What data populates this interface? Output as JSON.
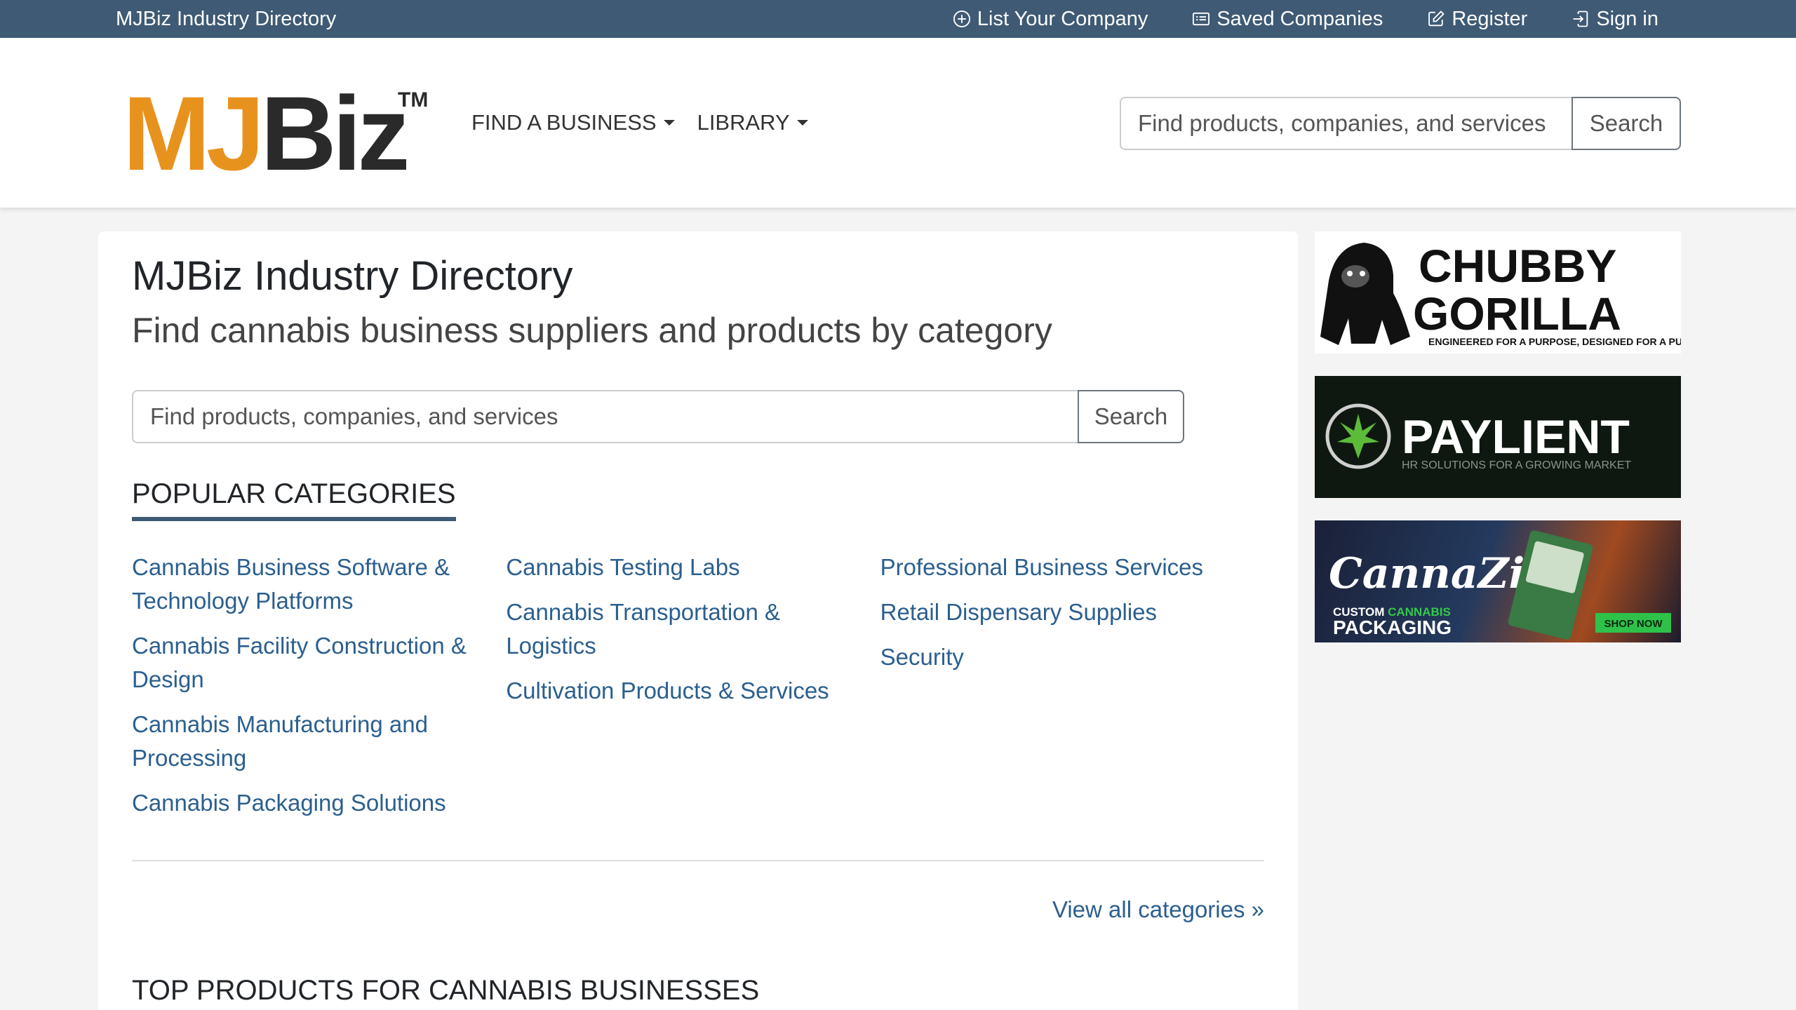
{
  "topbar": {
    "brand": "MJBiz Industry Directory",
    "links": {
      "list_company": "List Your Company",
      "saved_companies": "Saved Companies",
      "register": "Register",
      "sign_in": "Sign in"
    }
  },
  "header": {
    "logo_text": "MJBiz",
    "logo_tm": "TM",
    "nav": {
      "find_business": "FIND A BUSINESS",
      "library": "LIBRARY"
    },
    "search": {
      "placeholder": "Find products, companies, and services",
      "button": "Search"
    }
  },
  "main": {
    "title": "MJBiz Industry Directory",
    "subtitle": "Find cannabis business suppliers and products by category",
    "search": {
      "placeholder": "Find products, companies, and services",
      "button": "Search"
    },
    "popular_heading": "POPULAR CATEGORIES",
    "categories": {
      "col1": [
        "Cannabis Business Software & Technology Platforms",
        "Cannabis Facility Construction & Design",
        "Cannabis Manufacturing and Processing",
        "Cannabis Packaging Solutions"
      ],
      "col2": [
        "Cannabis Testing Labs",
        "Cannabis Transportation & Logistics",
        "Cultivation Products & Services"
      ],
      "col3": [
        "Professional Business Services",
        "Retail Dispensary Supplies",
        "Security"
      ]
    },
    "view_all": "View all categories »",
    "top_products_heading": "TOP PRODUCTS FOR CANNABIS BUSINESSES"
  },
  "ads": {
    "chubby": {
      "line1": "CHUBBY",
      "line2": "GORILLA",
      "tagline": "ENGINEERED FOR A PURPOSE, DESIGNED FOR A PURPOSE"
    },
    "paylient": {
      "name": "PAYLIENT",
      "tagline": "HR SOLUTIONS FOR A GROWING MARKET"
    },
    "cannazip": {
      "brand": "CannaZip",
      "line1a": "CUSTOM",
      "line1b": "CANNABIS",
      "line2": "PACKAGING",
      "cta": "SHOP NOW"
    }
  },
  "colors": {
    "topbar_bg": "#3e5a74",
    "link": "#2b5f8f",
    "logo_orange": "#e8921e",
    "logo_dark": "#2a2a2a"
  }
}
